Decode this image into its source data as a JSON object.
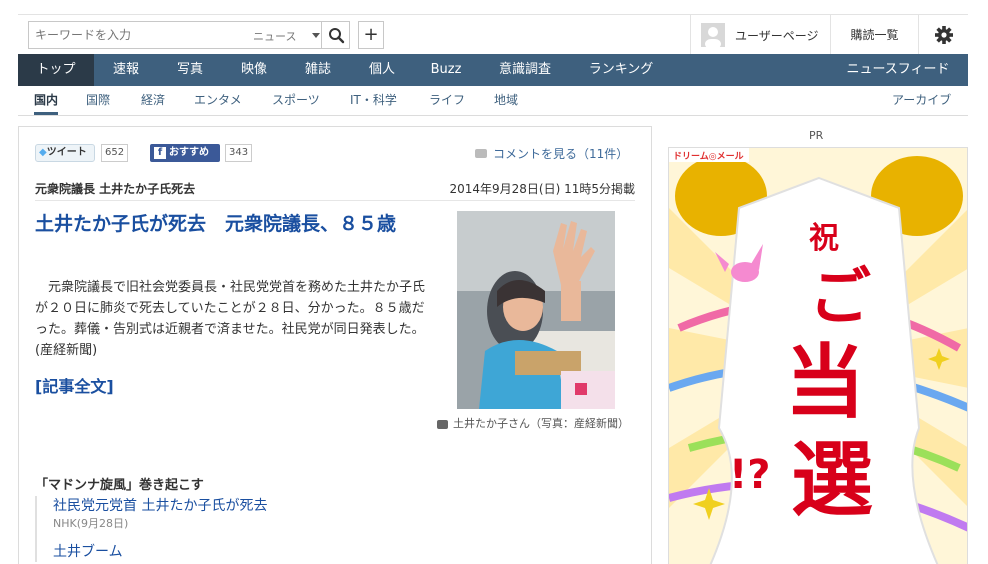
{
  "header": {
    "search_placeholder": "キーワードを入力",
    "search_category": "ニュース",
    "user_page": "ユーザーページ",
    "subscriptions": "購読一覧"
  },
  "main_nav": {
    "items": [
      "トップ",
      "速報",
      "写真",
      "映像",
      "雑誌",
      "個人",
      "Buzz",
      "意識調査",
      "ランキング"
    ],
    "active": "トップ",
    "feed": "ニュースフィード"
  },
  "sub_nav": {
    "items": [
      "国内",
      "国際",
      "経済",
      "エンタメ",
      "スポーツ",
      "IT・科学",
      "ライフ",
      "地域"
    ],
    "active": "国内",
    "archive": "アーカイブ"
  },
  "social": {
    "tweet_label": "ツイート",
    "tweet_count": "652",
    "fb_label": "おすすめ",
    "fb_count": "343",
    "comments": "コメントを見る（11件）"
  },
  "article": {
    "category": "元衆院議長 土井たか子氏死去",
    "date": "2014年9月28日(日) 11時5分掲載",
    "headline": "土井たか子氏が死去　元衆院議長、８５歳",
    "body": "元衆院議長で旧社会党委員長・社民党党首を務めた土井たか子氏が２０日に肺炎で死去していたことが２８日、分かった。８５歳だった。葬儀・告別式は近親者で済ませた。社民党が同日発表した。(産経新聞)",
    "full_link": "[記事全文]",
    "caption": "土井たか子さん（写真：産経新聞）"
  },
  "related": {
    "title": "「マドンナ旋風」巻き起こす",
    "items": [
      {
        "title": "社民党元党首 土井たか子氏が死去",
        "source": "NHK(9月28日)"
      },
      {
        "title": "土井ブーム",
        "source": ""
      }
    ]
  },
  "ad": {
    "label": "PR",
    "brand": "ドリーム◎メール",
    "shuku": "祝",
    "text1": "ご",
    "text2": "当",
    "text3": "選",
    "mark": "!?"
  }
}
